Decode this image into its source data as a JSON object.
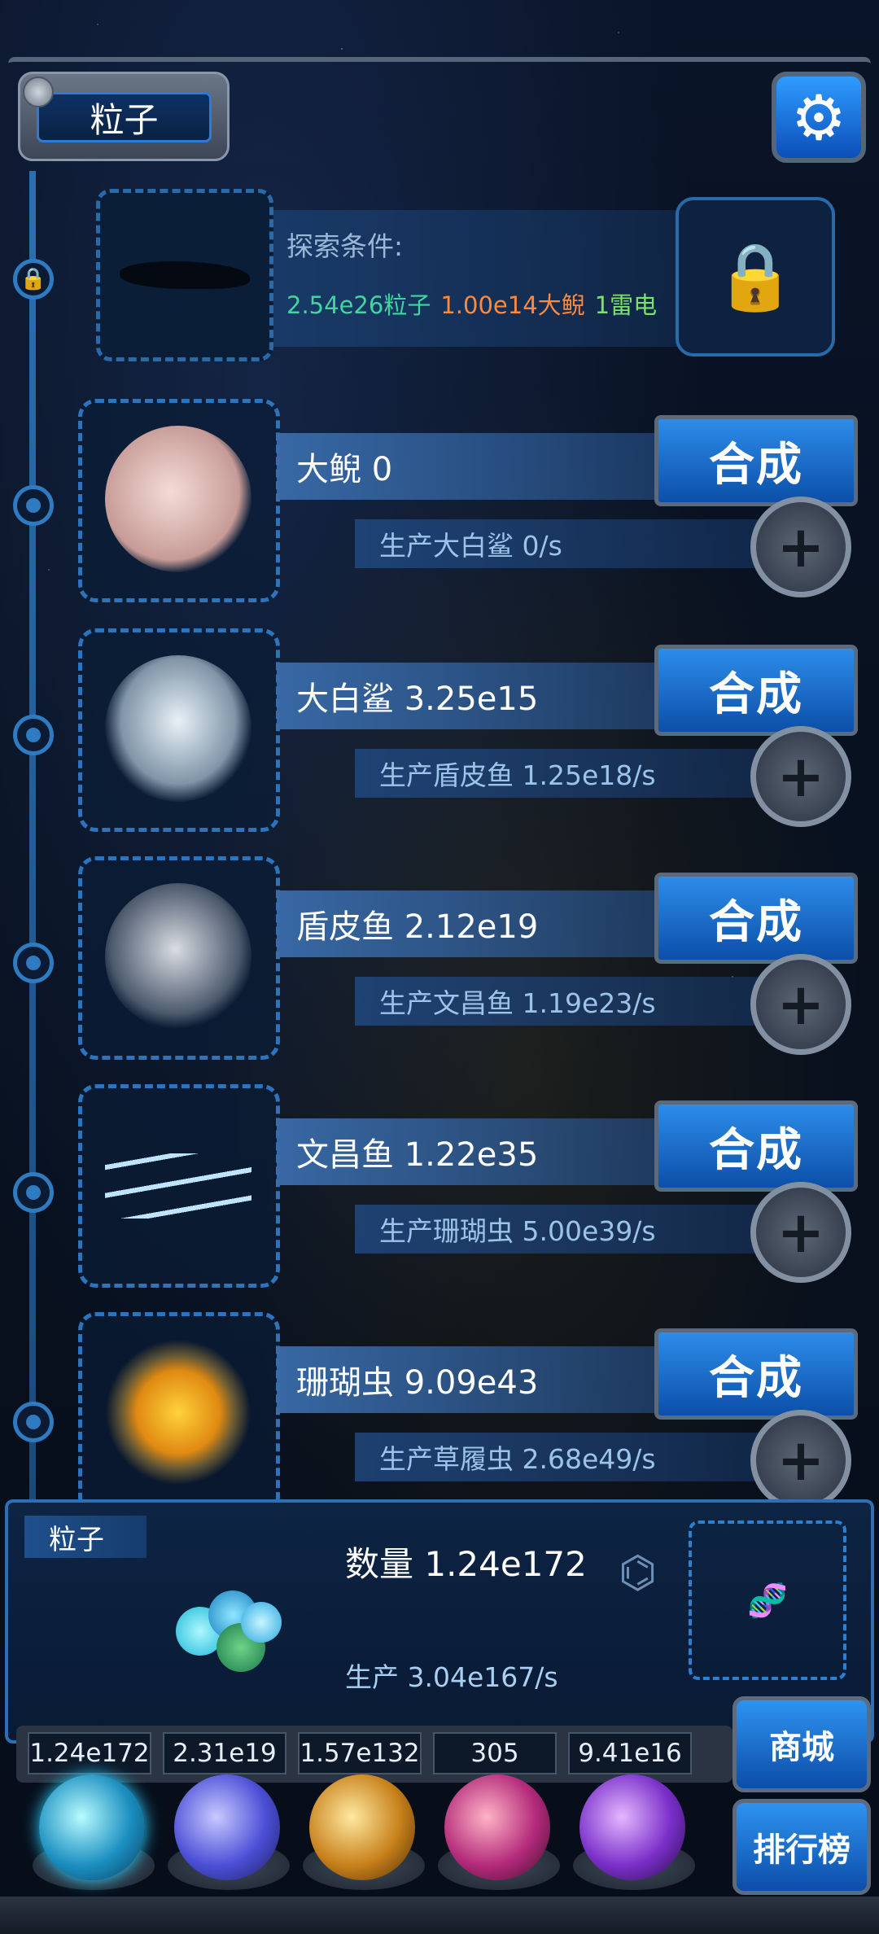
{
  "header": {
    "title": "粒子"
  },
  "explore": {
    "condition_label": "探索条件:",
    "costs": [
      {
        "text": "2.54e26粒子",
        "color": "#3fd6a0"
      },
      {
        "text": "1.00e14大鲵",
        "color": "#ff8a3d"
      },
      {
        "text": "1雷电",
        "color": "#7be36a"
      }
    ]
  },
  "creatures": [
    {
      "name": "大鲵 0",
      "production": "生产大白鲨 0/s",
      "merge_label": "合成",
      "icon": "axolotl-icon"
    },
    {
      "name": "大白鲨 3.25e15",
      "production": "生产盾皮鱼 1.25e18/s",
      "merge_label": "合成",
      "icon": "shark-icon"
    },
    {
      "name": "盾皮鱼 2.12e19",
      "production": "生产文昌鱼 1.19e23/s",
      "merge_label": "合成",
      "icon": "placoderm-icon"
    },
    {
      "name": "文昌鱼 1.22e35",
      "production": "生产珊瑚虫 5.00e39/s",
      "merge_label": "合成",
      "icon": "lancelet-icon"
    },
    {
      "name": "珊瑚虫 9.09e43",
      "production": "生产草履虫 2.68e49/s",
      "merge_label": "合成",
      "icon": "coral-polyp-icon"
    }
  ],
  "panel": {
    "tag": "粒子",
    "count": "数量 1.24e172",
    "production": "生产 3.04e167/s"
  },
  "resources": [
    "1.24e172",
    "2.31e19",
    "1.57e132",
    "305",
    "9.41e16"
  ],
  "side_buttons": {
    "shop": "商城",
    "ranking": "排行榜"
  },
  "colors": {
    "accent": "#2d8cea",
    "frame": "#5b6a7d",
    "green": "#3fd6a0",
    "orange": "#ff8a3d"
  }
}
